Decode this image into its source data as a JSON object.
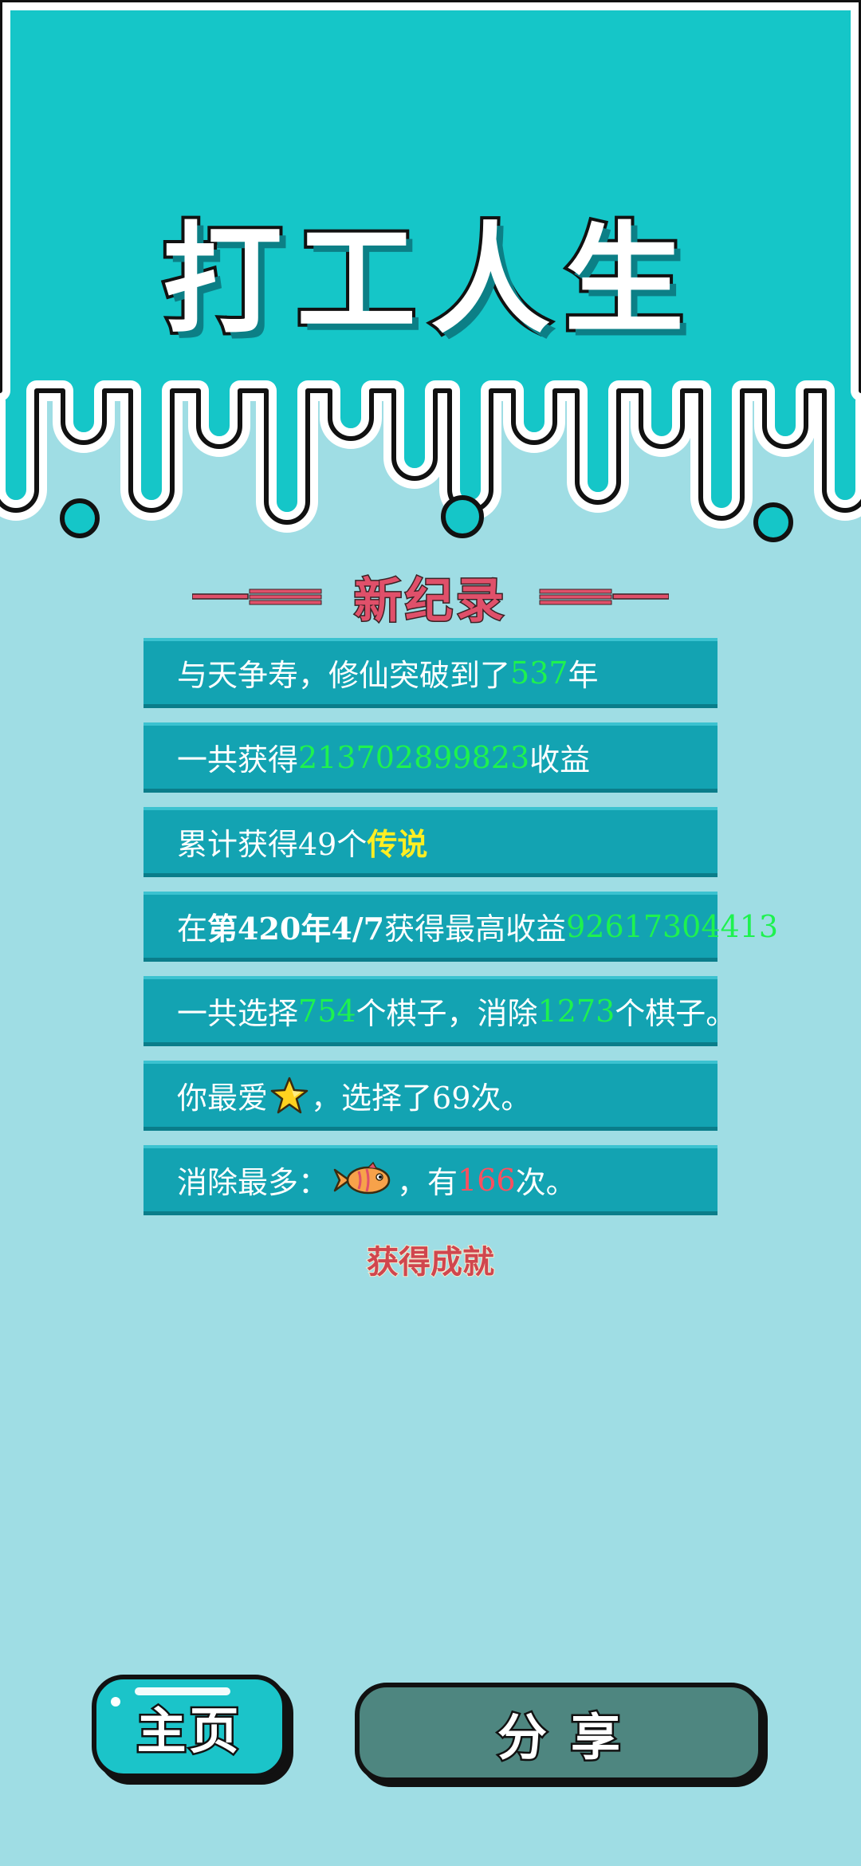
{
  "app": {
    "title": "打工人生"
  },
  "record": {
    "title": "新纪录"
  },
  "stats": [
    {
      "pre": "与天争寿，修仙突破到了",
      "value": "537",
      "post": "年"
    },
    {
      "pre": "一共获得",
      "value": "213702899823",
      "post": "收益"
    },
    {
      "pre": "累计获得49个",
      "value": "传说"
    },
    {
      "pre": "在",
      "date": "第420年4/7",
      "mid": "获得最高收益",
      "value": "92617304413"
    },
    {
      "pre": "一共选择",
      "value1": "754",
      "mid": "个棋子，消除",
      "value2": "1273",
      "post": "个棋子。"
    },
    {
      "pre": "你最爱",
      "icon": "star-icon",
      "post": "，选择了69次。"
    },
    {
      "pre": "消除最多：",
      "icon": "fish-icon",
      "mid": "，有",
      "value": "166",
      "post": "次。"
    }
  ],
  "achievement": {
    "label": "获得成就"
  },
  "buttons": {
    "home": "主页",
    "share": "分享"
  },
  "colors": {
    "background": "#9fdde4",
    "header": "#15c6c8",
    "row": "#13a3b2",
    "highlight_green": "#1ef24f",
    "highlight_yellow": "#ffee22",
    "highlight_red": "#ff4f5e",
    "record_title": "#e0506a",
    "share_button": "#4e8680",
    "home_button": "#1bc4c9"
  }
}
